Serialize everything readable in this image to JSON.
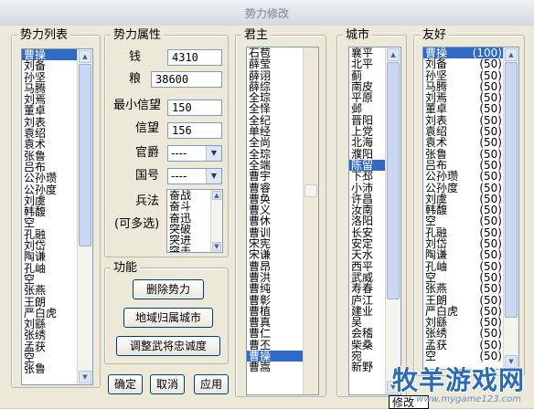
{
  "window": {
    "title": "势力修改"
  },
  "faction_list": {
    "label": "势力列表",
    "items": [
      "曹操",
      "刘备",
      "孙坚",
      "马腾",
      "刘焉",
      "董卓",
      "刘表",
      "袁绍",
      "袁术",
      "张鲁",
      "吕布",
      "公孙瓒",
      "公孙度",
      "刘虞",
      "韩馥",
      "空",
      "孔融",
      "刘岱",
      "陶谦",
      "孔岫",
      "空",
      "张燕",
      "王朗",
      "严白虎",
      "刘繇",
      "张绣",
      "孟获",
      "空",
      "张鲁"
    ],
    "selected": 0
  },
  "attributes": {
    "label": "势力属性",
    "money_label": "钱",
    "money_value": "4310",
    "food_label": "粮",
    "food_value": "38600",
    "min_trust_label": "最小信望",
    "min_trust_value": "150",
    "trust_label": "信望",
    "trust_value": "156",
    "rank_label": "官爵",
    "rank_value": "----",
    "country_label": "国号",
    "country_value": "----",
    "troops_label": "兵法",
    "multi_label": "(可多选)",
    "troops_items": [
      "奋战",
      "奋斗",
      "奋迅",
      "突破",
      "突进",
      "突击"
    ]
  },
  "functions": {
    "label": "功能",
    "delete_label": "删除势力",
    "region_label": "地域归属城市",
    "loyalty_label": "调整武将忠诚度"
  },
  "dialog_buttons": {
    "ok": "确定",
    "cancel": "取消",
    "apply": "应用"
  },
  "lord_list": {
    "label": "君主",
    "items": [
      "石苞",
      "薛莹",
      "薛诩",
      "薛综",
      "全琮",
      "全怿",
      "全纪",
      "单经",
      "全尚",
      "全琮",
      "全端",
      "曹宇",
      "曹睿",
      "曹奂",
      "曹义",
      "曹休",
      "曹训",
      "宋宪",
      "宋谦",
      "曹昂",
      "曹洪",
      "曹纯",
      "曹彰",
      "曹植",
      "曹真",
      "曹仁",
      "曹丕",
      "曹操",
      "曹嵩"
    ],
    "selected": 27
  },
  "city_list": {
    "label": "城市",
    "items": [
      "襄平",
      "北平",
      "蓟",
      "南皮",
      "平原",
      "邺",
      "晋阳",
      "上党",
      "北海",
      "濮阳",
      "陈留",
      "下邳",
      "小沛",
      "许昌",
      "汝南",
      "洛阳",
      "长安",
      "安定",
      "天水",
      "西平",
      "武威",
      "寿春",
      "庐江",
      "建业",
      "吴",
      "会稽",
      "柴桑",
      "宛",
      "新野"
    ],
    "selected": 10
  },
  "friend_list": {
    "label": "友好",
    "items": [
      {
        "name": "曹操",
        "value": "(100)"
      },
      {
        "name": "刘备",
        "value": "(50)"
      },
      {
        "name": "孙坚",
        "value": "(50)"
      },
      {
        "name": "马腾",
        "value": "(50)"
      },
      {
        "name": "刘焉",
        "value": "(50)"
      },
      {
        "name": "董卓",
        "value": "(50)"
      },
      {
        "name": "刘表",
        "value": "(50)"
      },
      {
        "name": "袁绍",
        "value": "(50)"
      },
      {
        "name": "袁术",
        "value": "(50)"
      },
      {
        "name": "张鲁",
        "value": "(50)"
      },
      {
        "name": "吕布",
        "value": "(50)"
      },
      {
        "name": "公孙瓒",
        "value": "(50)"
      },
      {
        "name": "公孙度",
        "value": "(50)"
      },
      {
        "name": "刘虞",
        "value": "(50)"
      },
      {
        "name": "韩馥",
        "value": "(50)"
      },
      {
        "name": "空",
        "value": "(50)"
      },
      {
        "name": "孔融",
        "value": "(50)"
      },
      {
        "name": "刘岱",
        "value": "(50)"
      },
      {
        "name": "陶谦",
        "value": "(50)"
      },
      {
        "name": "孔岫",
        "value": "(50)"
      },
      {
        "name": "空",
        "value": "(50)"
      },
      {
        "name": "张燕",
        "value": "(50)"
      },
      {
        "name": "王朗",
        "value": "(50)"
      },
      {
        "name": "严白虎",
        "value": "(50)"
      },
      {
        "name": "刘繇",
        "value": "(50)"
      },
      {
        "name": "张绣",
        "value": "(50)"
      },
      {
        "name": "孟获",
        "value": "(50)"
      },
      {
        "name": "空",
        "value": "(50)"
      }
    ],
    "selected": 0
  },
  "tooltip": "修改",
  "watermark": {
    "text": "牧羊游戏网",
    "url": "www.mygame123.com"
  },
  "colors": {
    "selection": "#316ac5",
    "border": "#7f9db9",
    "dialog_bg": "#ece9d8"
  }
}
